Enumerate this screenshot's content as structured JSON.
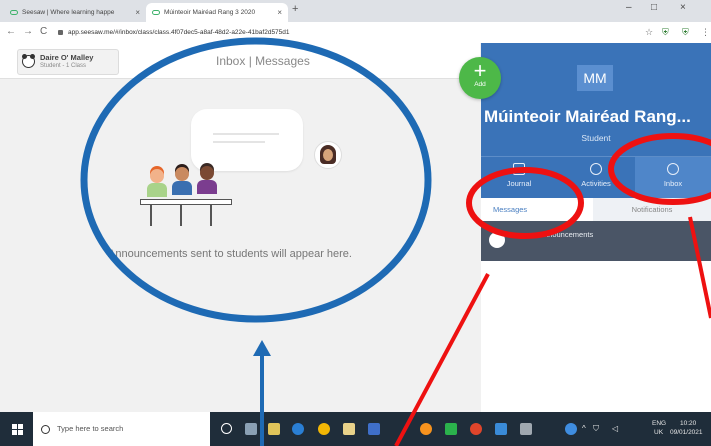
{
  "browser": {
    "tabs": [
      {
        "title": "Seesaw | Where learning happe"
      },
      {
        "title": "Múinteoir Mairéad Rang 3 2020"
      }
    ],
    "tab_close": "×",
    "new_tab": "+",
    "url": "app.seesaw.me/#/inbox/class/class.4f07dec5-a8af-48d2-a22e-41baf2d575d1",
    "nav": {
      "back": "←",
      "forward": "→",
      "reload": "C"
    },
    "window": {
      "minimize": "–",
      "maximize": "□",
      "close": "×"
    }
  },
  "app": {
    "user": {
      "name": "Daire O' Malley",
      "role": "Student - 1 Class"
    },
    "page_title": "Inbox | Messages",
    "empty_message": "Announcements sent to students will appear here.",
    "add_button": {
      "icon": "+",
      "label": "Add"
    }
  },
  "panel": {
    "initials": "MM",
    "class_name": "Múinteoir Mairéad Rang...",
    "role": "Student",
    "tabs": [
      {
        "label": "Journal",
        "icon": "journal-icon"
      },
      {
        "label": "Activities",
        "icon": "lightbulb-icon"
      },
      {
        "label": "Inbox",
        "icon": "chat-icon",
        "active": true
      }
    ],
    "subtabs": [
      {
        "label": "Messages",
        "active": true
      },
      {
        "label": "Notifications"
      }
    ],
    "announcements_label": "Announcements"
  },
  "taskbar": {
    "search_placeholder": "Type here to search",
    "language": "ENG",
    "region": "UK",
    "time": "10:20",
    "date": "09/01/2021"
  },
  "colors": {
    "panel_blue": "#3a73b8",
    "add_green": "#4db848",
    "annotation_blue": "#1e6ab4",
    "annotation_red": "#ee1111"
  }
}
